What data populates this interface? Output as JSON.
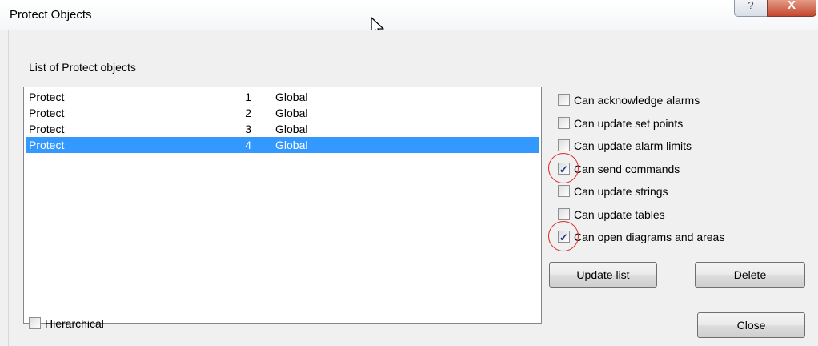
{
  "window": {
    "title": "Protect Objects",
    "help_glyph": "?",
    "close_glyph": "X"
  },
  "list": {
    "label": "List of Protect objects",
    "selected_index": 3,
    "rows": [
      {
        "name": "Protect",
        "num": "1",
        "scope": "Global"
      },
      {
        "name": "Protect",
        "num": "2",
        "scope": "Global"
      },
      {
        "name": "Protect",
        "num": "3",
        "scope": "Global"
      },
      {
        "name": "Protect",
        "num": "4",
        "scope": "Global"
      }
    ]
  },
  "permissions": [
    {
      "label": "Can acknowledge alarms",
      "checked": false,
      "highlight": false
    },
    {
      "label": "Can update set points",
      "checked": false,
      "highlight": false
    },
    {
      "label": "Can update alarm limits",
      "checked": false,
      "highlight": false
    },
    {
      "label": "Can send commands",
      "checked": true,
      "highlight": true
    },
    {
      "label": "Can update strings",
      "checked": false,
      "highlight": false
    },
    {
      "label": "Can update tables",
      "checked": false,
      "highlight": false
    },
    {
      "label": "Can open diagrams and areas",
      "checked": true,
      "highlight": true
    }
  ],
  "buttons": {
    "update_list": "Update list",
    "delete": "Delete",
    "close": "Close"
  },
  "hierarchical": {
    "label": "Hierarchical",
    "checked": false
  },
  "colors": {
    "selection": "#3399ff",
    "highlight_circle": "#d92a2a"
  }
}
